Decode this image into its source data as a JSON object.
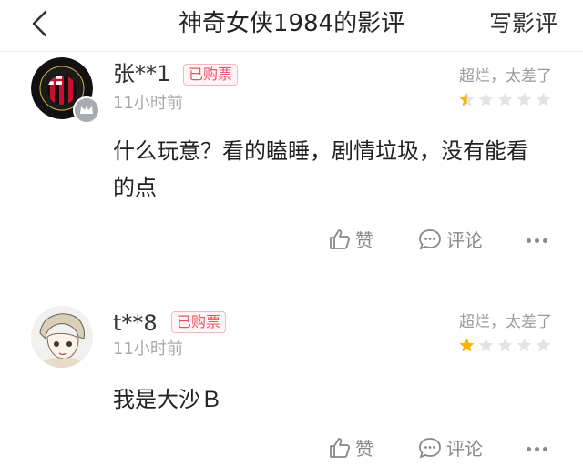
{
  "header": {
    "title": "神奇女侠1984的影评",
    "write_label": "写影评"
  },
  "reviews": [
    {
      "username": "张**1",
      "badge": "已购票",
      "time": "11小时前",
      "rating_text": "超烂，太差了",
      "stars": 0.5,
      "content": "什么玩意？看的瞌睡，剧情垃圾，没有能看的点",
      "like_label": "赞",
      "comment_label": "评论"
    },
    {
      "username": "t**8",
      "badge": "已购票",
      "time": "11小时前",
      "rating_text": "超烂，太差了",
      "stars": 1,
      "content": "我是大沙Ｂ",
      "like_label": "赞",
      "comment_label": "评论"
    }
  ],
  "colors": {
    "star_filled": "#f7b500",
    "star_empty": "#e3e3e3",
    "badge": "#e45663"
  }
}
